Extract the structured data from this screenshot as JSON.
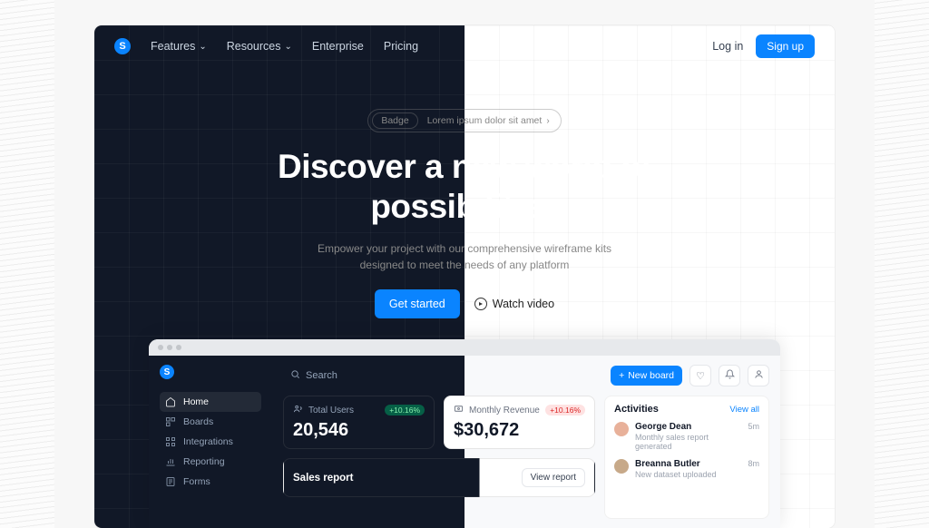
{
  "nav": {
    "items": [
      "Features",
      "Resources",
      "Enterprise",
      "Pricing"
    ],
    "login": "Log in",
    "signup": "Sign up"
  },
  "hero": {
    "badge_pill": "Badge",
    "badge_text": "Lorem ipsum dolor sit amet",
    "title_l1": "Discover a new world of",
    "title_l2": "possibilities",
    "sub_l1": "Empower your project with our comprehensive wireframe kits",
    "sub_l2": "designed to meet the needs of any platform",
    "cta_primary": "Get started",
    "cta_secondary": "Watch video"
  },
  "app": {
    "search_placeholder": "Search",
    "new_board": "New board",
    "sidebar": {
      "items": [
        {
          "icon": "home",
          "label": "Home",
          "active": true
        },
        {
          "icon": "boards",
          "label": "Boards"
        },
        {
          "icon": "integrations",
          "label": "Integrations"
        },
        {
          "icon": "reporting",
          "label": "Reporting"
        },
        {
          "icon": "forms",
          "label": "Forms"
        }
      ]
    },
    "stats": [
      {
        "icon": "users",
        "label": "Total Users",
        "value": "20,546",
        "change": "+10.16%",
        "trend": "up"
      },
      {
        "icon": "revenue",
        "label": "Monthly Revenue",
        "value": "$30,672",
        "change": "+10.16%",
        "trend": "down"
      }
    ],
    "report": {
      "title": "Sales report",
      "button": "View report"
    },
    "activities": {
      "title": "Activities",
      "view_all": "View all",
      "items": [
        {
          "name": "George Dean",
          "desc": "Monthly sales report generated",
          "time": "5m"
        },
        {
          "name": "Breanna Butler",
          "desc": "New dataset uploaded",
          "time": "8m"
        }
      ]
    }
  }
}
